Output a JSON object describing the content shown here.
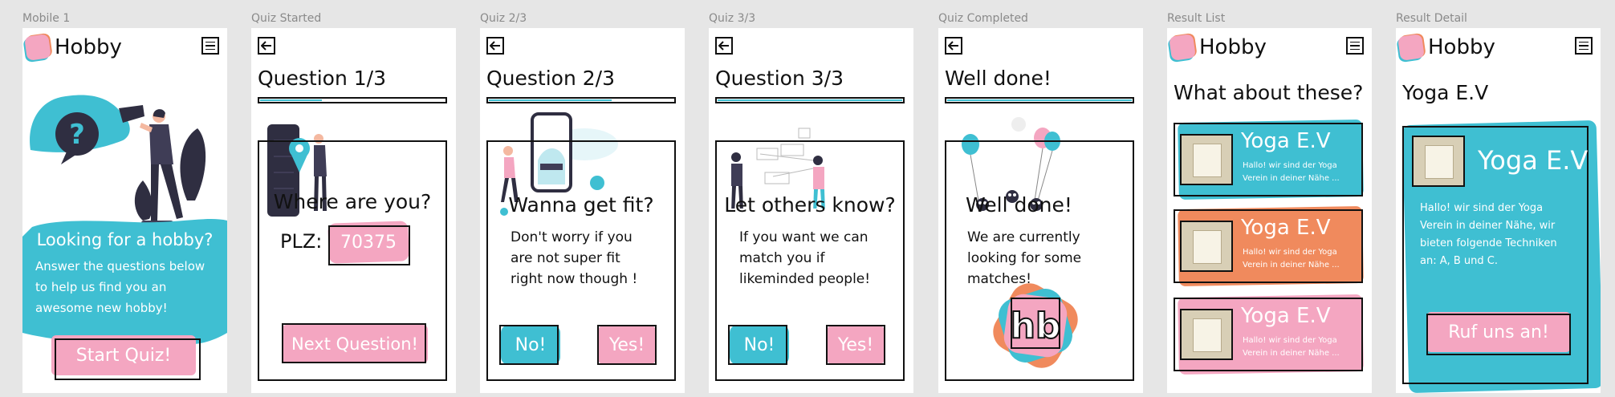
{
  "frames": {
    "mobile1": {
      "label": "Mobile 1",
      "brand": "Hobby",
      "heading": "Looking for a hobby?",
      "text": "Answer the questions below to help us find you an awesome new hobby!",
      "cta": "Start Quiz!"
    },
    "quiz_started": {
      "label": "Quiz Started",
      "title": "Question 1/3",
      "progress": 0.34,
      "question": "Where are you?",
      "field_label": "PLZ:",
      "field_value": "70375",
      "next_button": "Next Question!"
    },
    "quiz_2": {
      "label": "Quiz 2/3",
      "title": "Question 2/3",
      "progress": 0.67,
      "question": "Wanna get fit?",
      "text": "Don't worry if you are not super fit right now though !",
      "no_button": "No!",
      "yes_button": "Yes!"
    },
    "quiz_3": {
      "label": "Quiz 3/3",
      "title": "Question 3/3",
      "progress": 1.0,
      "question": "Let others know?",
      "text": "If you want we can match you if likeminded people!",
      "no_button": "No!",
      "yes_button": "Yes!"
    },
    "quiz_completed": {
      "label": "Quiz Completed",
      "title": "Well done!",
      "progress": 1.0,
      "heading": "Well done!",
      "text": "We are currently looking for some matches!",
      "logo_text": "hb"
    },
    "result_list": {
      "label": "Result List",
      "brand": "Hobby",
      "heading": "What about these?",
      "items": [
        {
          "name": "Yoga E.V",
          "desc": "Hallo! wir sind der Yoga Verein in deiner Nähe ..."
        },
        {
          "name": "Yoga E.V",
          "desc": "Hallo! wir sind der Yoga Verein in deiner Nähe ..."
        },
        {
          "name": "Yoga E.V",
          "desc": "Hallo! wir sind der Yoga Verein in deiner Nähe ..."
        }
      ]
    },
    "result_detail": {
      "label": "Result Detail",
      "brand": "Hobby",
      "heading": "Yoga E.V",
      "name": "Yoga E.V",
      "desc": "Hallo! wir sind der Yoga Verein in deiner Nähe, wir bieten folgende Techniken an: A, B und C.",
      "cta": "Ruf uns an!"
    }
  },
  "colors": {
    "cyan": "#3fbfd2",
    "pink": "#f4a6c1",
    "orange": "#f08a5d",
    "dark": "#2f2e41",
    "purple": "#3f3d56"
  },
  "icons": [
    "menu-icon",
    "back-arrow-icon",
    "question-mark-icon",
    "logo-icon"
  ]
}
